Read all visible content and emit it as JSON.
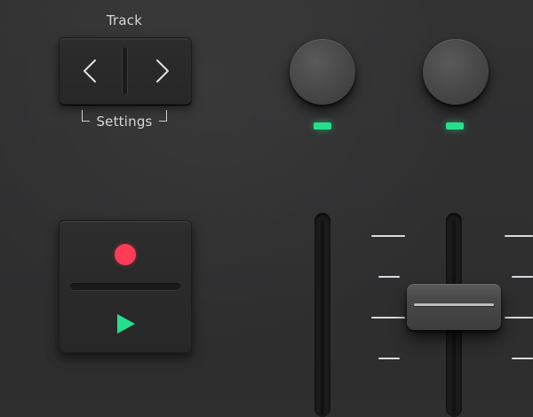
{
  "track": {
    "title": "Track",
    "settings_label": "Settings",
    "prev_icon": "chevron-left-icon",
    "next_icon": "chevron-right-icon"
  },
  "transport": {
    "record_icon": "record-icon",
    "play_icon": "play-icon"
  },
  "knobs": [
    {
      "id": "knob-1",
      "led": "on"
    },
    {
      "id": "knob-2",
      "led": "on"
    }
  ],
  "colors": {
    "background": "#2f2f30",
    "record": "#ff3b56",
    "play": "#25e08a",
    "led": "#25e08a",
    "label": "#d7d7d7"
  }
}
